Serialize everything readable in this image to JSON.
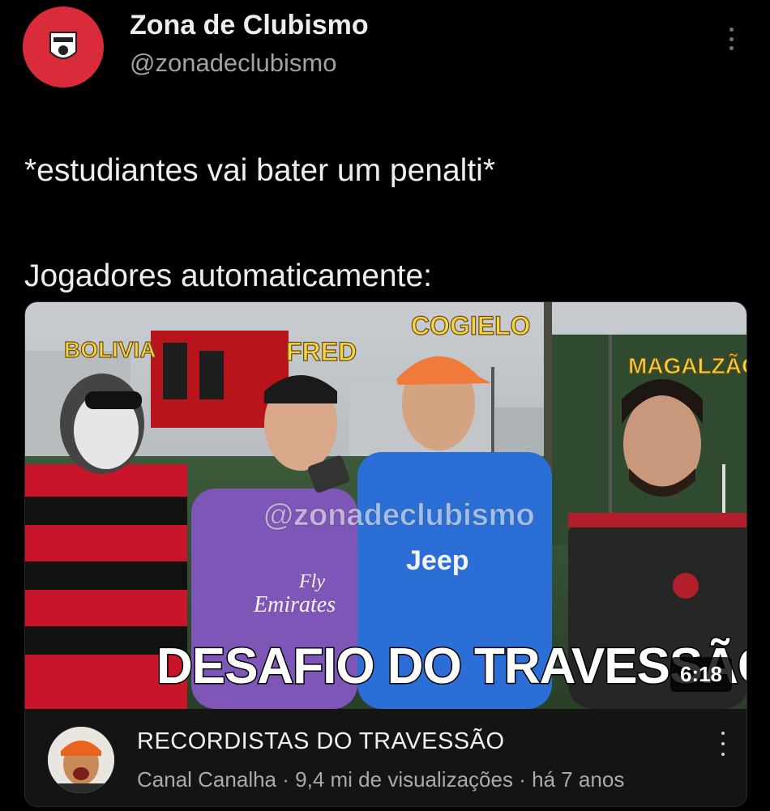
{
  "tweet": {
    "display_name": "Zona de Clubismo",
    "handle": "@zonadeclubismo",
    "text_line1": "*estudiantes vai bater um penalti*",
    "text_line2": "Jogadores automaticamente:",
    "avatar_icon": "club-badge-icon",
    "more_icon": "more-vertical-icon"
  },
  "video": {
    "thumbnail_labels": {
      "bolivia": "BOLIVIA",
      "fred": "FRED",
      "cogielo": "COGIELO",
      "magalzao": "MAGALZÃO"
    },
    "watermark": "@zonadeclubismo",
    "headline": "DESAFIO DO TRAVESSÃO",
    "jersey_text_1": "Fly",
    "jersey_text_2": "Emirates",
    "jersey_text_3": "Jeep",
    "duration": "6:18",
    "title": "RECORDISTAS DO TRAVESSÃO",
    "channel": "Canal Canalha",
    "views": "9,4 mi de visualizações",
    "age": "há 7 anos",
    "separator": "·"
  },
  "colors": {
    "background": "#000000",
    "avatar_red": "#d92b3a",
    "label_yellow": "#f5d44a"
  }
}
